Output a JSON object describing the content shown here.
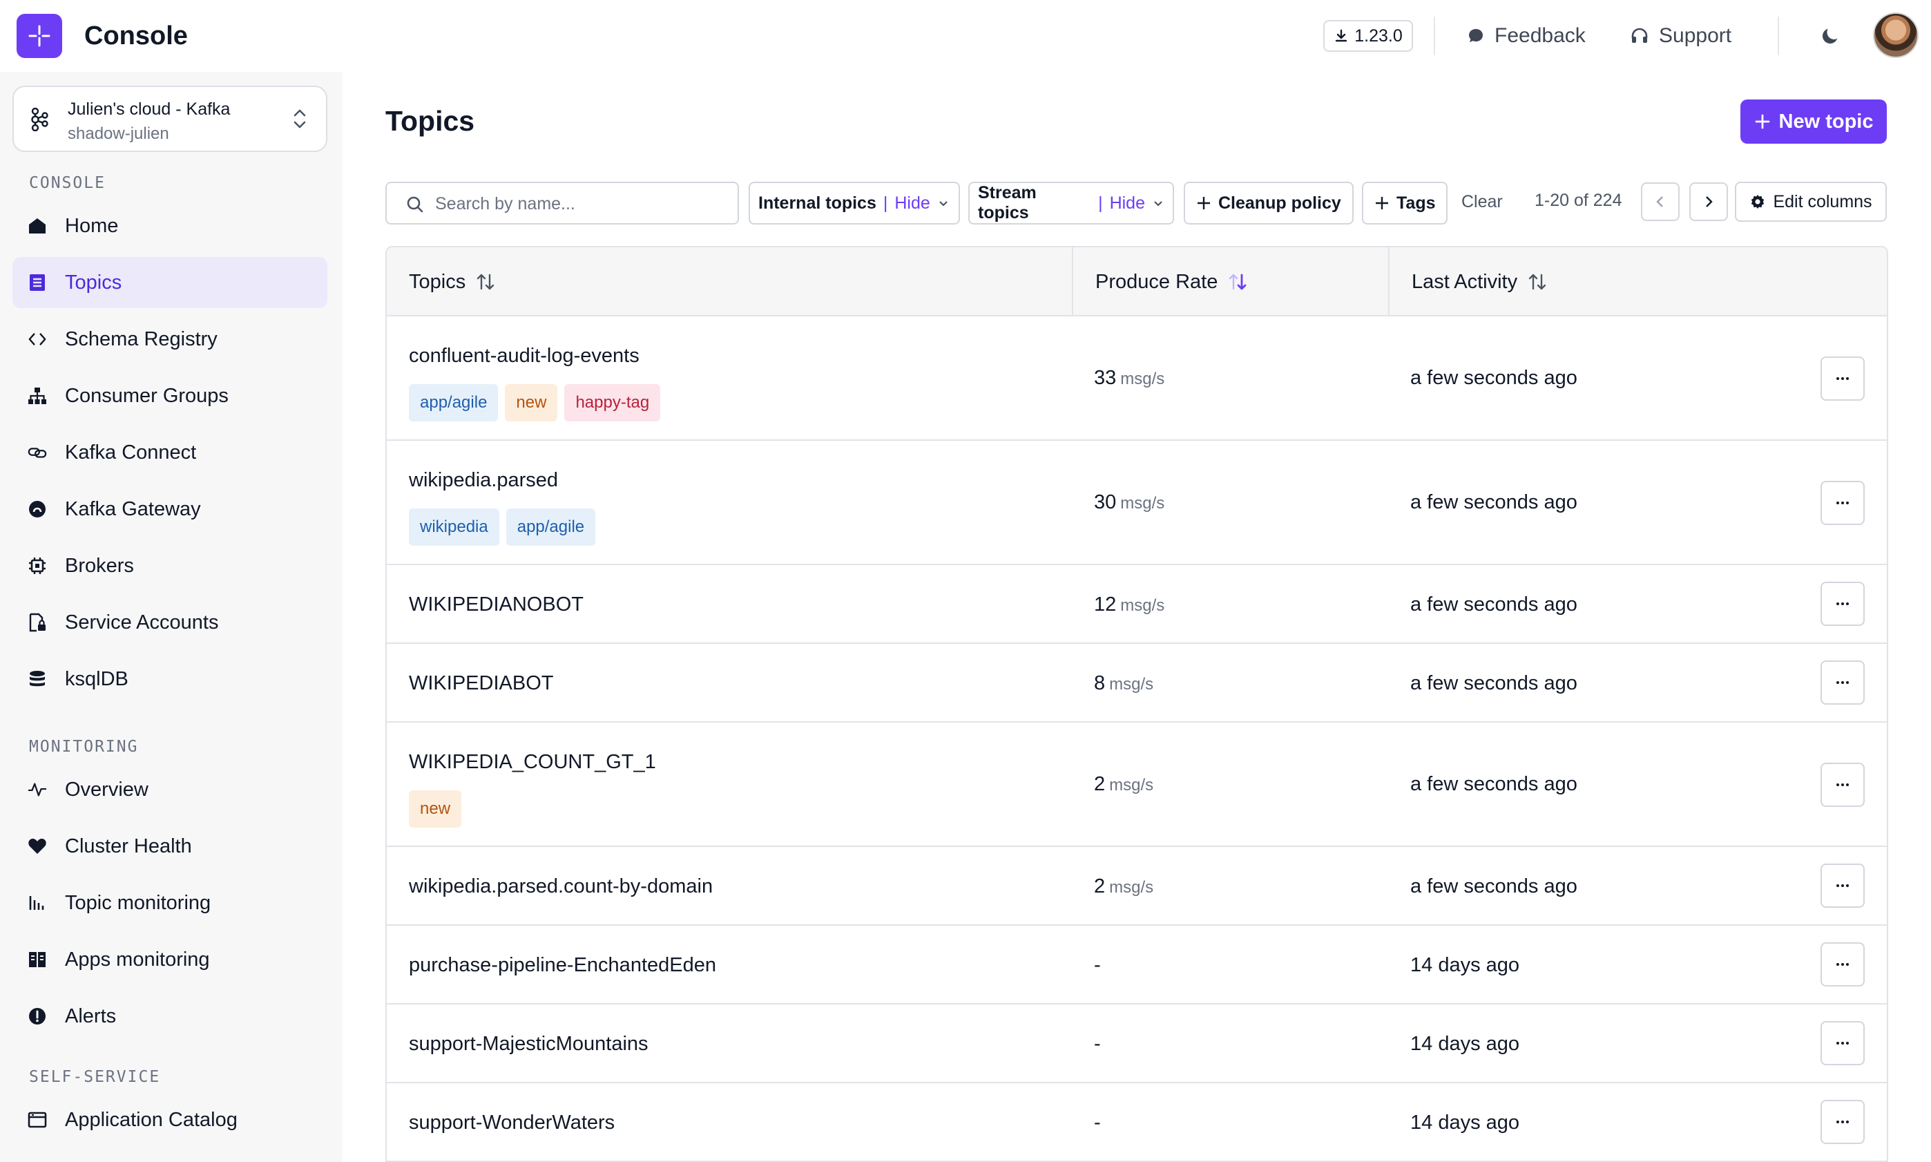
{
  "app": {
    "title": "Console",
    "version": "1.23.0"
  },
  "header": {
    "feedback": "Feedback",
    "support": "Support"
  },
  "cluster": {
    "name": "Julien's cloud - Kafka",
    "sub": "shadow-julien"
  },
  "sidebar": {
    "sections": [
      {
        "label": "CONSOLE"
      },
      {
        "label": "MONITORING"
      },
      {
        "label": "SELF-SERVICE"
      }
    ],
    "items": [
      {
        "label": "Home",
        "icon": "home-icon"
      },
      {
        "label": "Topics",
        "icon": "topics-icon",
        "active": true
      },
      {
        "label": "Schema Registry",
        "icon": "code-icon"
      },
      {
        "label": "Consumer Groups",
        "icon": "hierarchy-icon"
      },
      {
        "label": "Kafka Connect",
        "icon": "link-icon"
      },
      {
        "label": "Kafka Gateway",
        "icon": "gateway-icon"
      },
      {
        "label": "Brokers",
        "icon": "chip-icon"
      },
      {
        "label": "Service Accounts",
        "icon": "file-lock-icon"
      },
      {
        "label": "ksqlDB",
        "icon": "database-icon"
      },
      {
        "label": "Overview",
        "icon": "pulse-icon"
      },
      {
        "label": "Cluster Health",
        "icon": "heart-icon"
      },
      {
        "label": "Topic monitoring",
        "icon": "bar-chart-icon"
      },
      {
        "label": "Apps monitoring",
        "icon": "apps-icon"
      },
      {
        "label": "Alerts",
        "icon": "alert-icon"
      },
      {
        "label": "Application Catalog",
        "icon": "catalog-icon"
      }
    ]
  },
  "main": {
    "title": "Topics",
    "new_topic": "New topic",
    "search": {
      "placeholder": "Search by name...",
      "value": ""
    },
    "filters": {
      "internal": {
        "name": "Internal topics",
        "value": "Hide"
      },
      "stream": {
        "name": "Stream topics",
        "value": "Hide"
      },
      "separator": "|",
      "cleanup": "Cleanup policy",
      "tags": "Tags",
      "clear": "Clear"
    },
    "pager": "1-20 of 224",
    "edit_columns": "Edit columns",
    "columns": {
      "topics": "Topics",
      "produce_rate": "Produce Rate",
      "last_activity": "Last Activity"
    },
    "rows": [
      {
        "name": "confluent-audit-log-events",
        "rate": "33",
        "unit": "msg/s",
        "activity": "a few seconds ago",
        "tags": [
          {
            "label": "app/agile",
            "color": "blue"
          },
          {
            "label": "new",
            "color": "orange"
          },
          {
            "label": "happy-tag",
            "color": "pink"
          }
        ]
      },
      {
        "name": "wikipedia.parsed",
        "rate": "30",
        "unit": "msg/s",
        "activity": "a few seconds ago",
        "tags": [
          {
            "label": "wikipedia",
            "color": "blue"
          },
          {
            "label": "app/agile",
            "color": "blue"
          }
        ]
      },
      {
        "name": "WIKIPEDIANOBOT",
        "rate": "12",
        "unit": "msg/s",
        "activity": "a few seconds ago",
        "tags": []
      },
      {
        "name": "WIKIPEDIABOT",
        "rate": "8",
        "unit": "msg/s",
        "activity": "a few seconds ago",
        "tags": []
      },
      {
        "name": "WIKIPEDIA_COUNT_GT_1",
        "rate": "2",
        "unit": "msg/s",
        "activity": "a few seconds ago",
        "tags": [
          {
            "label": "new",
            "color": "orange"
          }
        ]
      },
      {
        "name": "wikipedia.parsed.count-by-domain",
        "rate": "2",
        "unit": "msg/s",
        "activity": "a few seconds ago",
        "tags": []
      },
      {
        "name": "purchase-pipeline-EnchantedEden",
        "rate": "-",
        "unit": "",
        "activity": "14 days ago",
        "tags": []
      },
      {
        "name": "support-MajesticMountains",
        "rate": "-",
        "unit": "",
        "activity": "14 days ago",
        "tags": []
      },
      {
        "name": "support-WonderWaters",
        "rate": "-",
        "unit": "",
        "activity": "14 days ago",
        "tags": []
      }
    ]
  },
  "colors": {
    "accent": "#6d3df5",
    "active_bg": "#ece9fb",
    "sidebar_bg": "#f7f7f8"
  }
}
